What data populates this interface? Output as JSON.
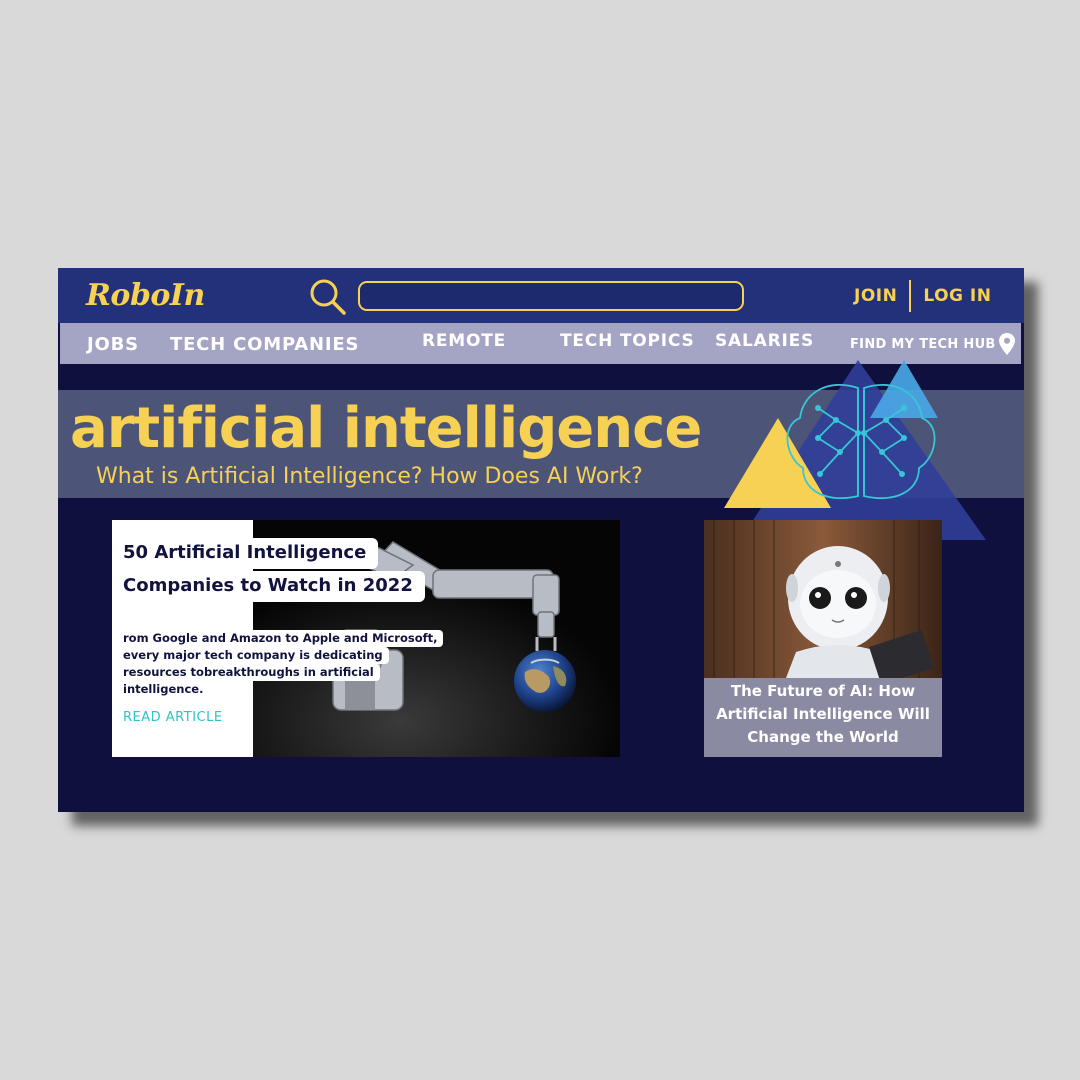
{
  "brand": {
    "logo": "RoboIn"
  },
  "search": {
    "placeholder": ""
  },
  "auth": {
    "join": "JOIN",
    "login": "LOG IN"
  },
  "nav": {
    "jobs": "JOBS",
    "tech_companies": "TECH COMPANIES",
    "remote": "REMOTE",
    "tech_topics": "TECH TOPICS",
    "salaries": "SALARIES",
    "find_hub": "FIND MY TECH HUB"
  },
  "hero": {
    "title": "artificial intelligence",
    "subtitle": "What is Artificial Intelligence? How Does AI Work?"
  },
  "featured": {
    "title_line1": "50 Artificial Intelligence",
    "title_line2": "Companies to Watch in 2022",
    "desc_lines": [
      "rom Google and Amazon to Apple and Microsoft,",
      "every major tech company is dedicating",
      "resources tobreakthroughs in artificial",
      "intelligence."
    ],
    "cta": "READ ARTICLE"
  },
  "side_article": {
    "caption": "The Future of AI: How Artificial Intelligence Will Change the World"
  },
  "colors": {
    "background": "#d9d9d9",
    "window": "#10103f",
    "topbar": "#23307a",
    "navbar": "#a4a4c4",
    "accent_yellow": "#f7d154",
    "link_teal": "#2cc4c4",
    "hero_band": "#4c5478"
  },
  "icons": {
    "search": "search-icon",
    "location": "map-pin-icon",
    "brain": "brain-network-icon"
  }
}
